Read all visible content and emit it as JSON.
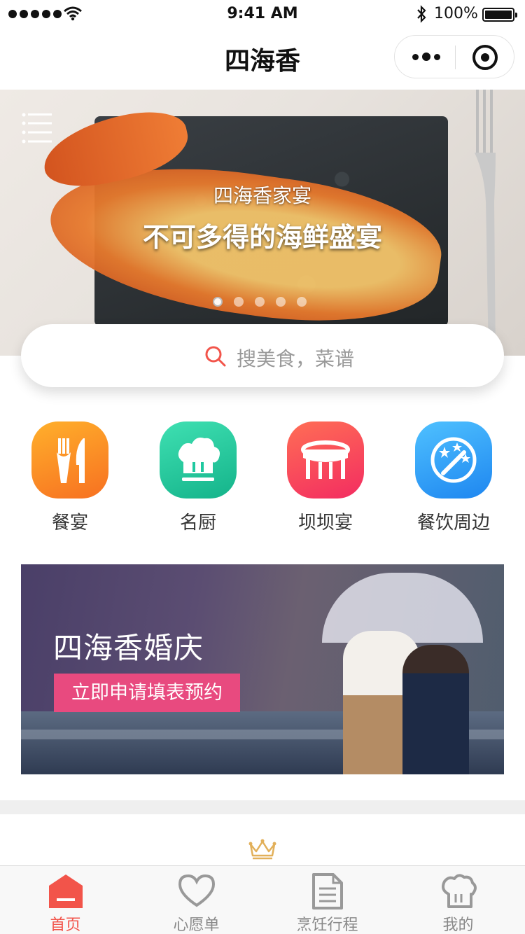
{
  "status_bar": {
    "time": "9:41 AM",
    "battery": "100%"
  },
  "nav": {
    "title": "四海香"
  },
  "hero": {
    "subtitle": "四海香家宴",
    "title": "不可多得的海鲜盛宴",
    "slides": 5,
    "active_slide": 1
  },
  "search": {
    "placeholder": "搜美食，菜谱"
  },
  "categories": [
    {
      "label": "餐宴",
      "icon": "fork-knife-icon",
      "color": "#f77f22"
    },
    {
      "label": "名厨",
      "icon": "chef-hat-icon",
      "color": "#1fc9a0"
    },
    {
      "label": "坝坝宴",
      "icon": "table-icon",
      "color": "#f9465b"
    },
    {
      "label": "餐饮周边",
      "icon": "stars-wand-icon",
      "color": "#2f9bf2"
    }
  ],
  "wedding": {
    "headline": "四海香婚庆",
    "cta": "立即申请填表预约"
  },
  "tabs": [
    {
      "label": "首页",
      "icon": "home-icon",
      "active": true
    },
    {
      "label": "心愿单",
      "icon": "heart-icon",
      "active": false
    },
    {
      "label": "烹饪行程",
      "icon": "document-icon",
      "active": false
    },
    {
      "label": "我的",
      "icon": "chef-hat-icon",
      "active": false
    }
  ],
  "colors": {
    "accent": "#f2544a",
    "cta": "#e84a7f",
    "crown": "#e2b05a"
  }
}
